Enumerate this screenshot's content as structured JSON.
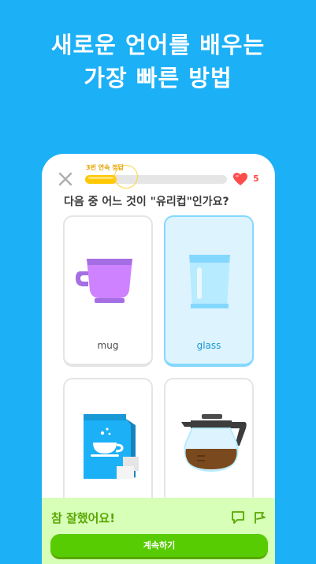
{
  "headline": {
    "line1": "새로운 언어를 배우는",
    "line2": "가장 빠른 방법"
  },
  "lesson": {
    "streak_label": "3번 연속 정답",
    "progress": 0.22,
    "hearts": "5",
    "question": "다음 중 어느 것이 \"유리컵\"인가요?"
  },
  "choices": [
    {
      "label": "mug",
      "icon": "mug-icon",
      "selected": false
    },
    {
      "label": "glass",
      "icon": "glass-icon",
      "selected": true
    },
    {
      "label": "",
      "icon": "coffee-bag-icon",
      "selected": false
    },
    {
      "label": "",
      "icon": "coffee-pot-icon",
      "selected": false
    }
  ],
  "feedback": {
    "title": "참 잘했어요!",
    "continue_label": "계속하기"
  },
  "colors": {
    "background": "#1cb0f6",
    "progress": "#ffc800",
    "heart": "#ff4b4b",
    "success": "#58cc02",
    "feedback_bg": "#d7ffb8",
    "selected_card": "#ddf4ff"
  }
}
